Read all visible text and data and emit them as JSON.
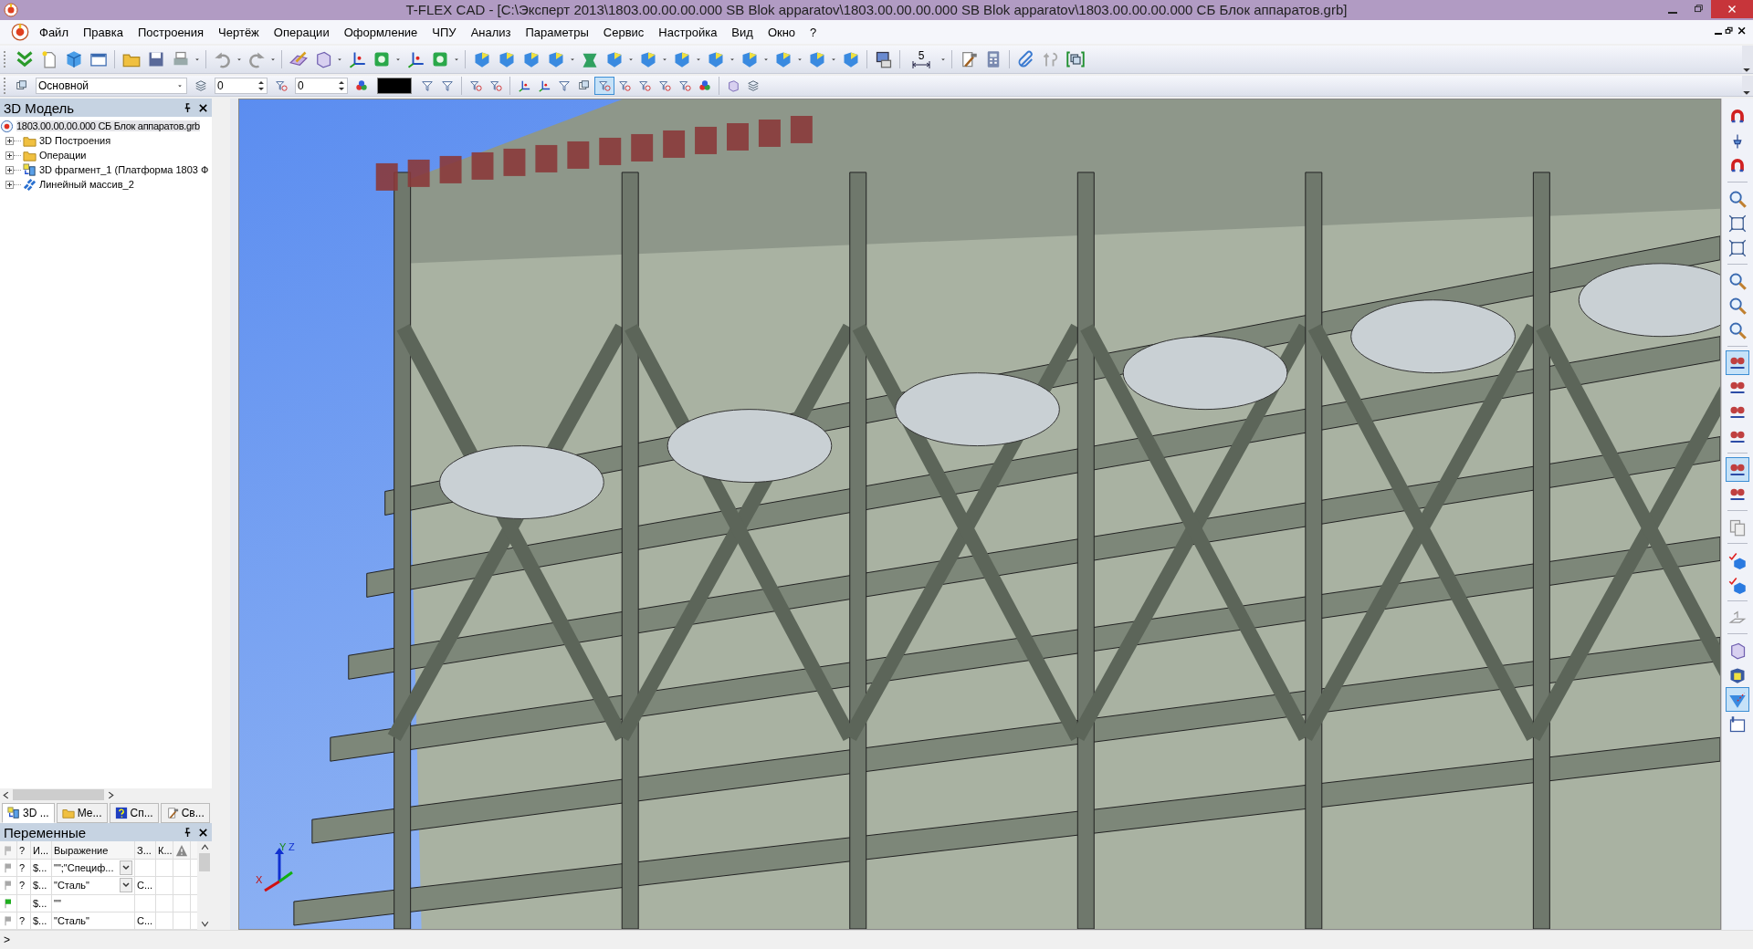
{
  "window": {
    "title": "T-FLEX CAD - [C:\\Эксперт 2013\\1803.00.00.00.000 SB Blok apparatov\\1803.00.00.00.000 SB Blok apparatov\\1803.00.00.00.000 СБ Блок аппаратов.grb]"
  },
  "menu": [
    "Файл",
    "Правка",
    "Построения",
    "Чертёж",
    "Операции",
    "Оформление",
    "ЧПУ",
    "Анализ",
    "Параметры",
    "Сервис",
    "Настройка",
    "Вид",
    "Окно",
    "?"
  ],
  "toolbar": {
    "dimension_label": "5"
  },
  "properties_bar": {
    "layer": "Основной",
    "level_1": "0",
    "level_2": "0",
    "buttons": [
      {
        "pressed": false
      },
      {
        "pressed": false
      },
      {
        "pressed": false
      },
      {
        "pressed": false
      },
      {
        "pressed": false
      },
      {
        "pressed": false
      },
      {
        "pressed": false
      },
      {
        "pressed": false
      },
      {
        "pressed": true
      },
      {
        "pressed": false
      },
      {
        "pressed": false
      },
      {
        "pressed": false
      },
      {
        "pressed": false
      },
      {
        "pressed": false
      },
      {
        "pressed": false
      },
      {
        "pressed": false
      }
    ]
  },
  "model_panel": {
    "title": "3D Модель",
    "tree": [
      {
        "label": "1803.00.00.00.000 СБ Блок аппаратов.grb",
        "kind": "root",
        "selected": true,
        "children": [
          {
            "label": "3D Построения",
            "kind": "folder",
            "expanded": false,
            "selected": false
          },
          {
            "label": "Операции",
            "kind": "folder",
            "expanded": false,
            "selected": false
          },
          {
            "label": "3D фрагмент_1 (Платформа 1803 Ф",
            "kind": "fragment",
            "expanded": false,
            "selected": false
          },
          {
            "label": "Линейный массив_2",
            "kind": "array",
            "expanded": false,
            "selected": false
          }
        ]
      }
    ],
    "tabs": [
      {
        "label": "3D ...",
        "kind": "model",
        "selected": true
      },
      {
        "label": "Ме...",
        "kind": "menu",
        "selected": false
      },
      {
        "label": "Сп...",
        "kind": "help",
        "selected": false
      },
      {
        "label": "Св...",
        "kind": "props",
        "selected": false
      }
    ]
  },
  "variables_panel": {
    "title": "Переменные",
    "columns": [
      "?",
      "И...",
      "Выражение",
      "З...",
      "К..."
    ],
    "rows": [
      {
        "color": "#a8a8a8",
        "mark": "?",
        "name": "$...",
        "expression": "\"\";\"Специф...",
        "dropdown": true,
        "column_4": ""
      },
      {
        "color": "#a8a8a8",
        "mark": "?",
        "name": "$...",
        "expression": "\"Сталь\"",
        "dropdown": true,
        "column_4": "С..."
      },
      {
        "color": "#1fae1f",
        "mark": "",
        "name": "$...",
        "expression": "\"\"",
        "dropdown": false,
        "column_4": ""
      },
      {
        "color": "#a8a8a8",
        "mark": "?",
        "name": "$...",
        "expression": "\"Сталь\"",
        "dropdown": false,
        "column_4": "С..."
      }
    ]
  },
  "viewport": {
    "axes": {
      "x": "X",
      "y": "Y",
      "z": "Z"
    }
  },
  "right_toolbar": {
    "buttons": [
      {
        "pressed": false
      },
      {
        "pressed": false
      },
      {
        "pressed": false
      },
      {
        "pressed": false
      },
      {
        "pressed": false
      },
      {
        "pressed": false
      },
      {
        "pressed": false
      },
      {
        "pressed": false
      },
      {
        "pressed": false
      },
      {
        "pressed": true
      },
      {
        "pressed": false
      },
      {
        "pressed": false
      },
      {
        "pressed": false
      },
      {
        "pressed": true
      },
      {
        "pressed": false
      },
      {
        "pressed": false
      },
      {
        "pressed": false
      },
      {
        "pressed": false
      },
      {
        "pressed": false
      },
      {
        "pressed": false
      },
      {
        "pressed": false
      },
      {
        "pressed": true
      },
      {
        "pressed": false
      }
    ]
  },
  "status_bar": {
    "prompt": ">"
  }
}
